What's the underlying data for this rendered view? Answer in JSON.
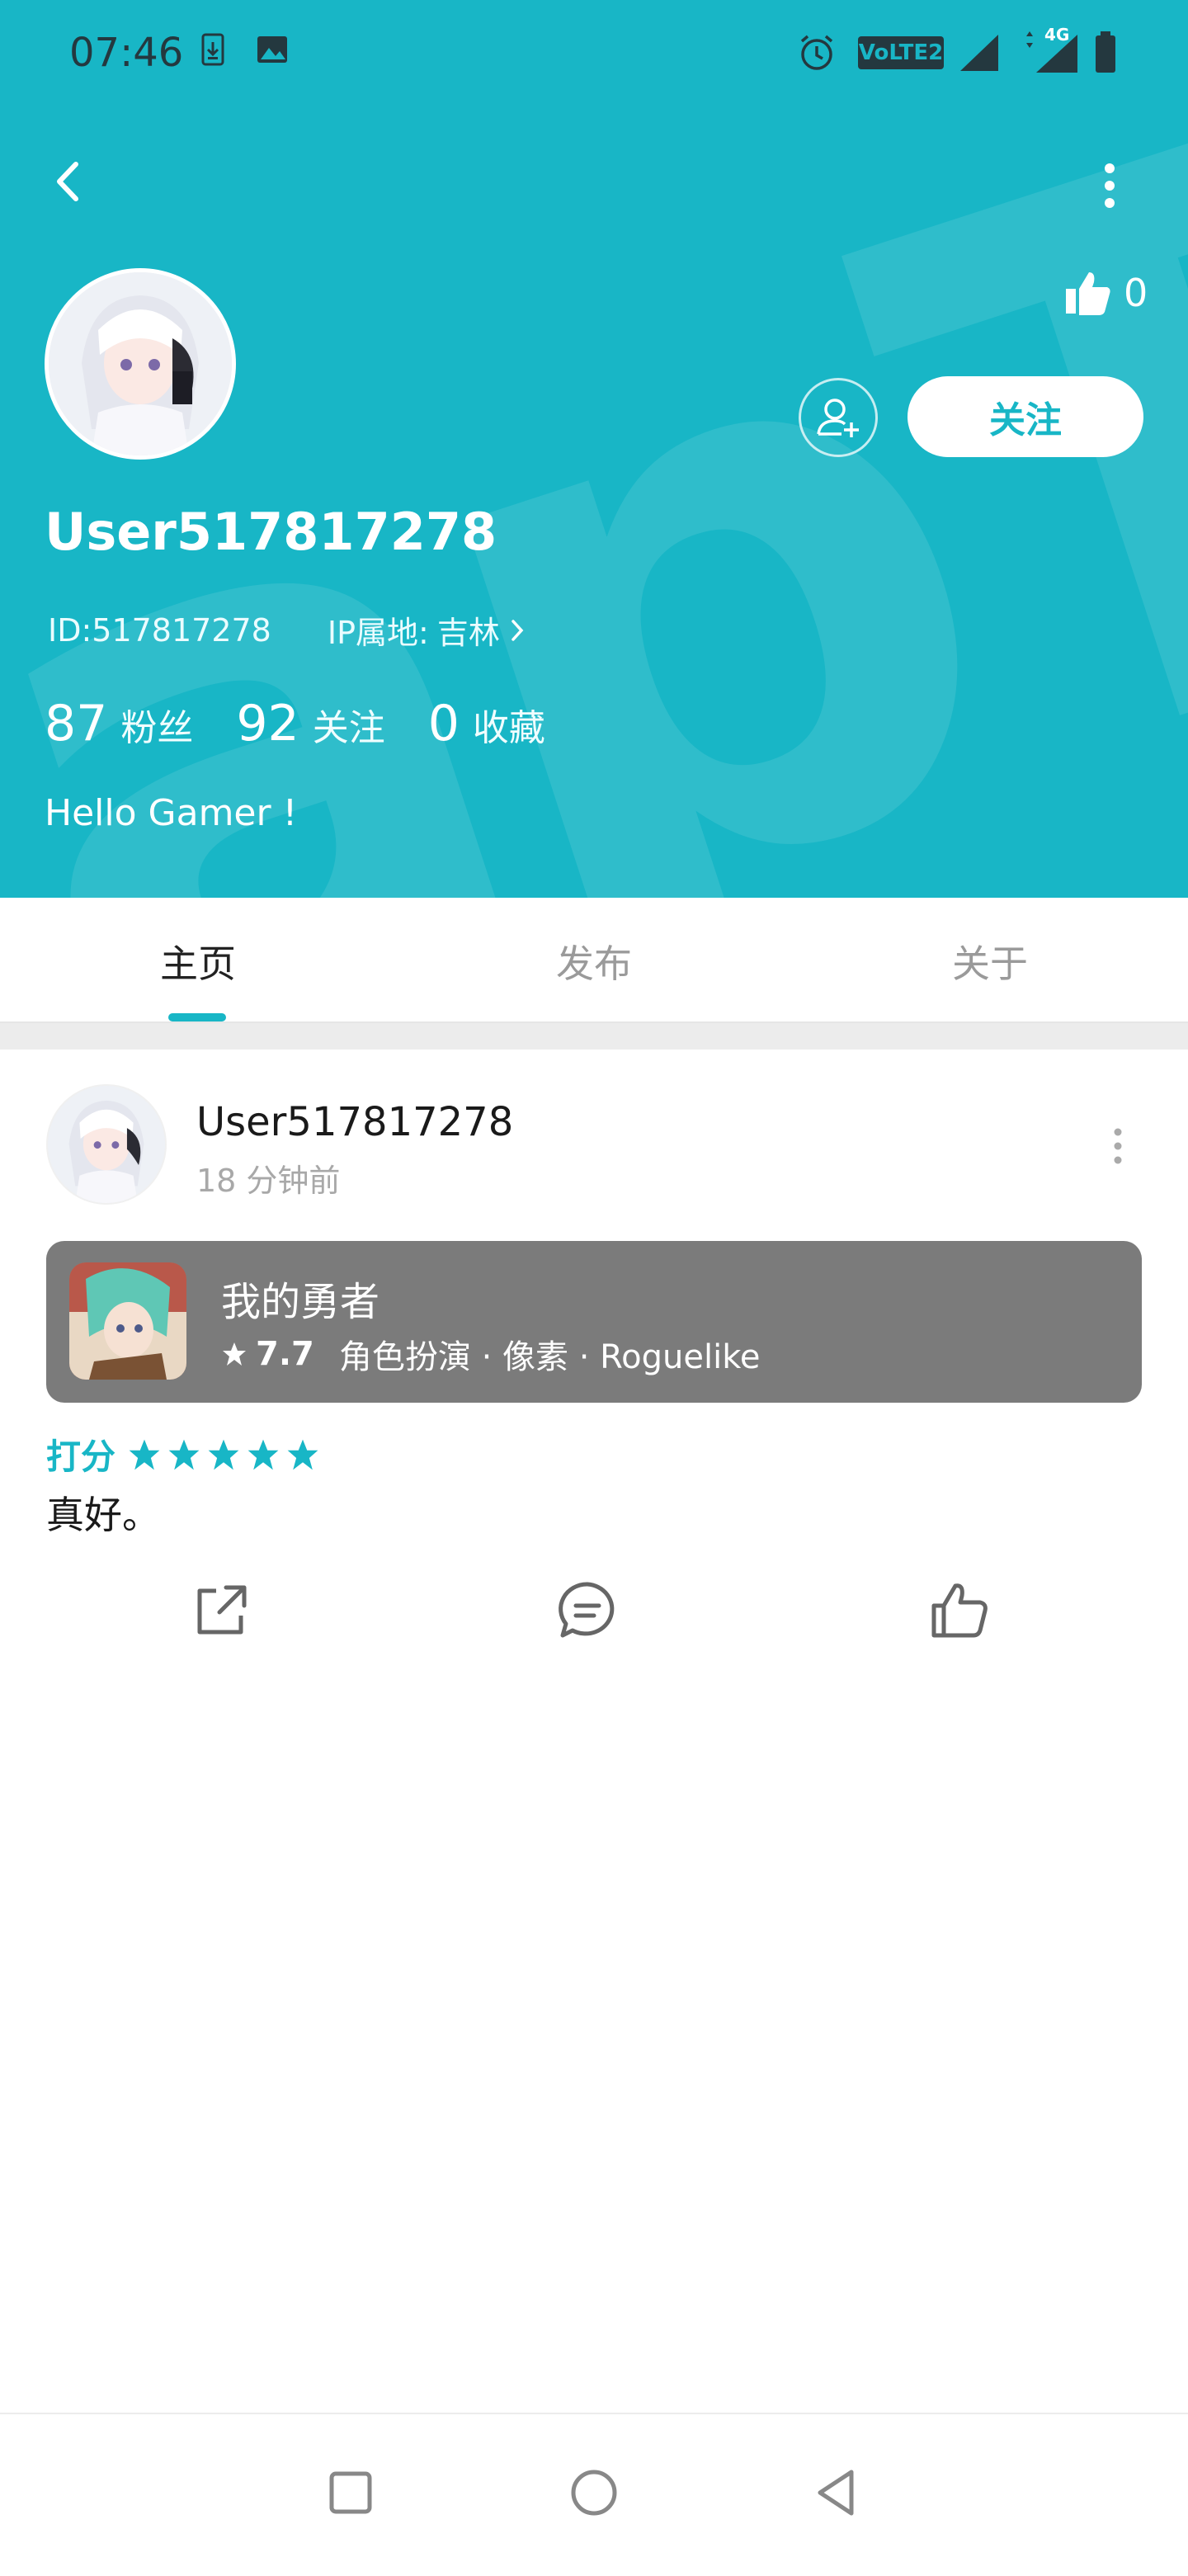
{
  "status_bar": {
    "time": "07:46",
    "icons": [
      "download-icon",
      "image-icon",
      "alarm-icon",
      "volte-icon",
      "signal-icon",
      "4g-signal-icon",
      "battery-icon"
    ],
    "volte_label": "VoLTE2",
    "network_label": "4G"
  },
  "header": {
    "background_color": "#18b6c6",
    "watermark": "apTap",
    "username": "User517817278",
    "id_text": "ID:517817278",
    "ip_label": "IP属地:",
    "ip_value": "吉林",
    "like_count": "0",
    "follow_label": "关注",
    "bio": "Hello Gamer !",
    "stats": [
      {
        "value": "87",
        "label": "粉丝"
      },
      {
        "value": "92",
        "label": "关注"
      },
      {
        "value": "0",
        "label": "收藏"
      }
    ]
  },
  "tabs": [
    {
      "label": "主页",
      "active": true
    },
    {
      "label": "发布",
      "active": false
    },
    {
      "label": "关于",
      "active": false
    }
  ],
  "post": {
    "username": "User517817278",
    "time": "18 分钟前",
    "game": {
      "title": "我的勇者",
      "score": "7.7",
      "tags": "角色扮演 · 像素 · Roguelike"
    },
    "rating_label": "打分",
    "rating_stars": 5,
    "review": "真好。"
  },
  "colors": {
    "accent": "#18b6c6",
    "card": "#7b7b7b"
  }
}
